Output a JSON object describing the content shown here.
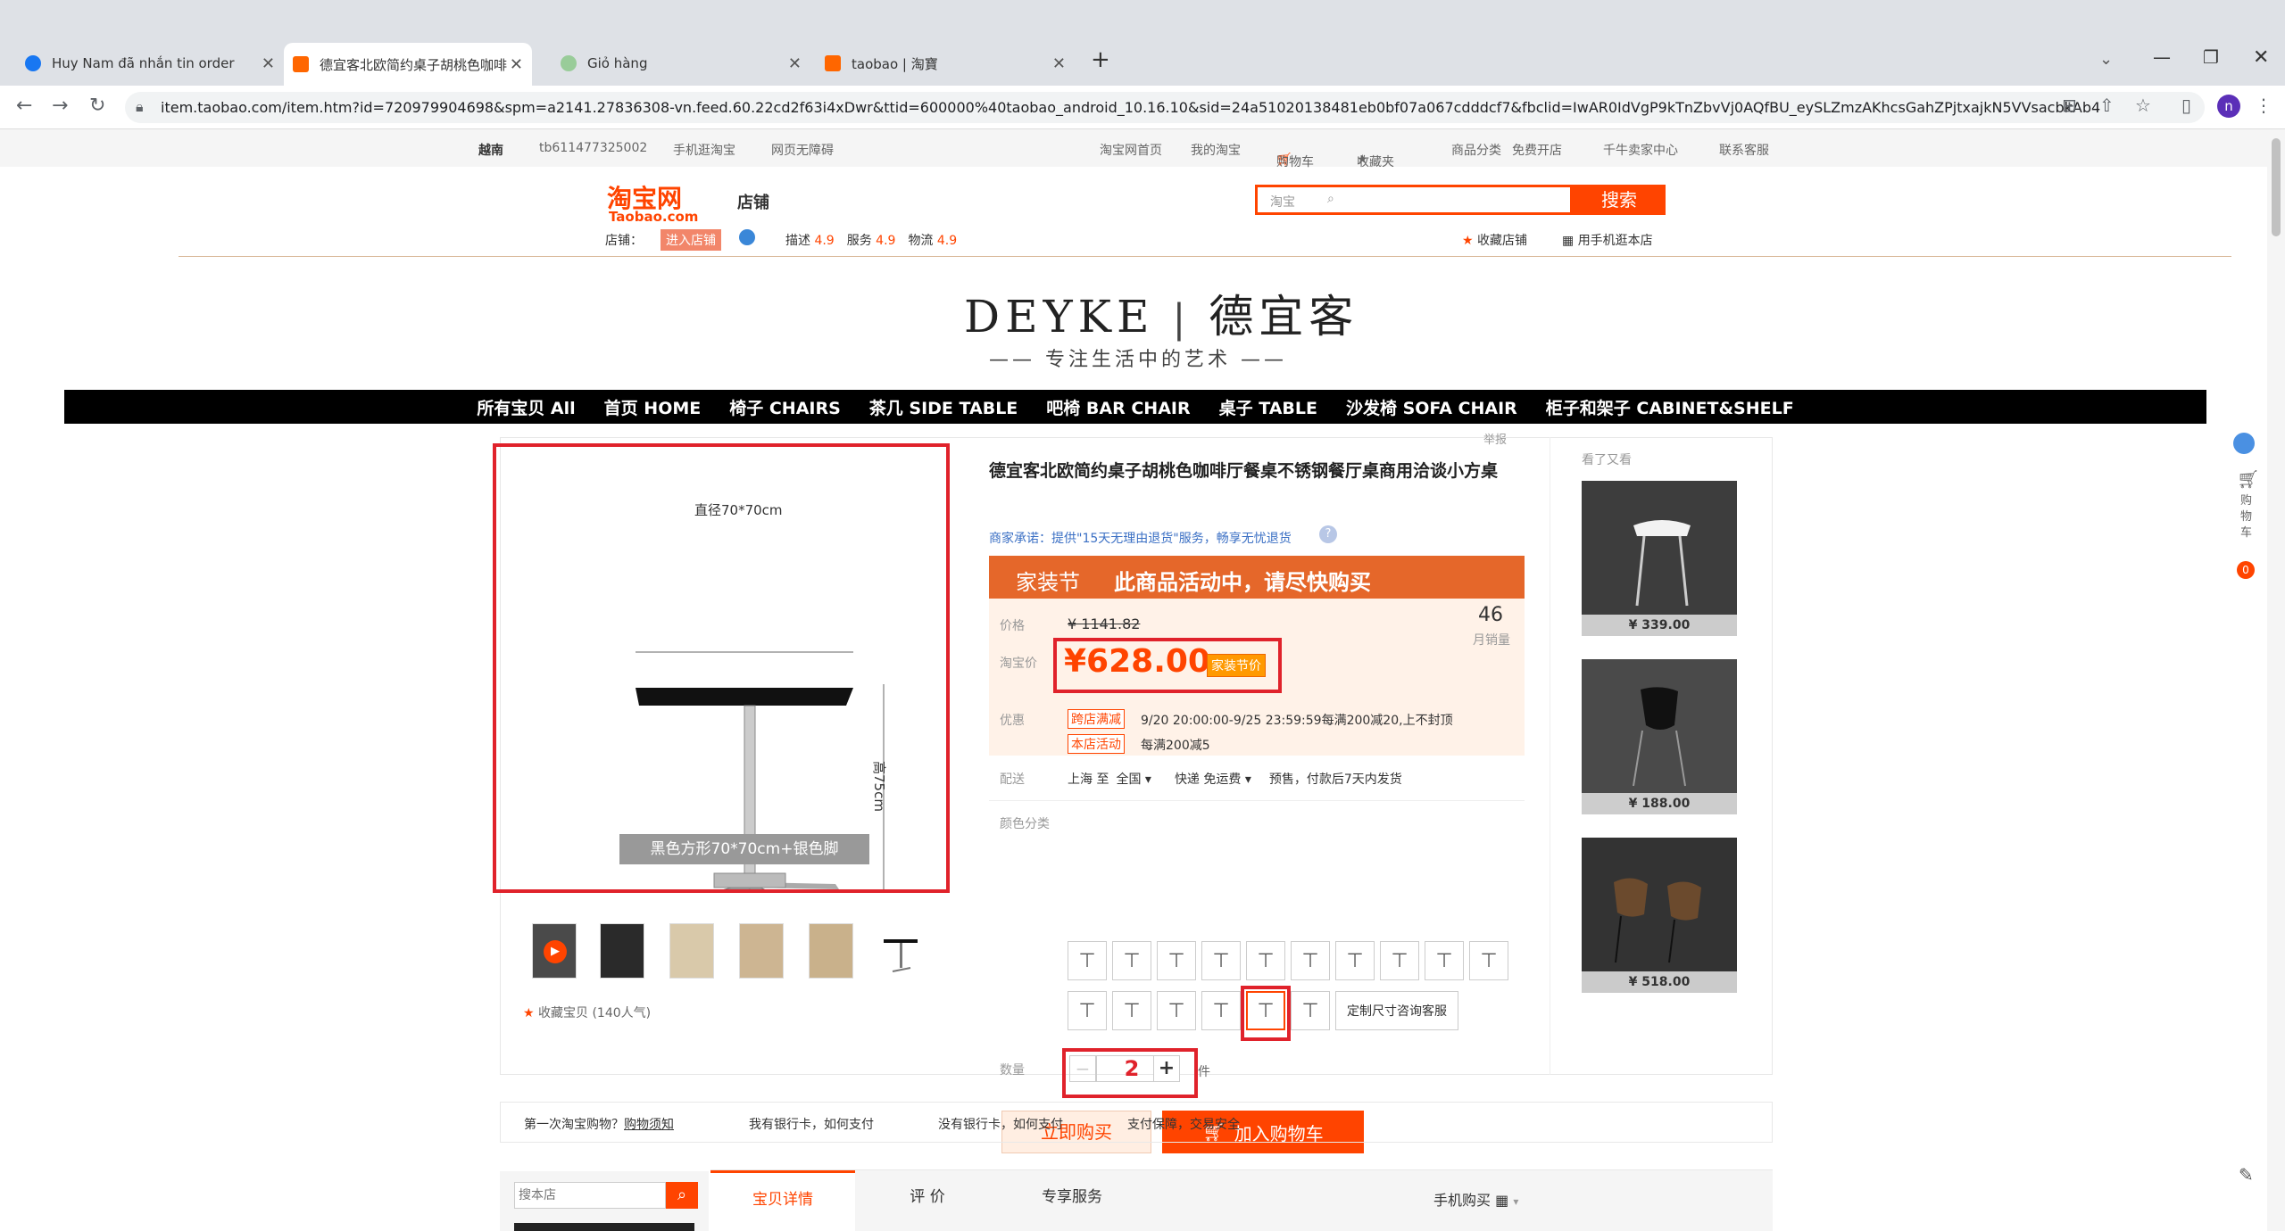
{
  "browser": {
    "tabs": [
      {
        "title": "Huy Nam đã nhắn tin order",
        "icon": "facebook-icon"
      },
      {
        "title": "德宜客北欧简约桌子胡桃色咖啡厅",
        "icon": "taobao-icon"
      },
      {
        "title": "Giỏ hàng",
        "icon": "globe-icon"
      },
      {
        "title": "taobao | 淘寶",
        "icon": "taobao-icon"
      }
    ],
    "new_tab": "+",
    "url": "item.taobao.com/item.htm?id=720979904698&spm=a2141.27836308-vn.feed.60.22cd2f63i4xDwr&ttid=600000%40taobao_android_10.16.10&sid=24a51020138481eb0bf07a067cdddcf7&fbclid=IwAR0IdVgP9kTnZbvVj0AQfBU_eySLZmzAKhcsGahZPjtxajkN5VVsacbkAb4",
    "profile": "n"
  },
  "sitebar": {
    "region": "越南",
    "user": "tb611477325002",
    "mobile": "手机逛淘宝",
    "accessible": "网页无障碍",
    "home": "淘宝网首页",
    "my": "我的淘宝",
    "cart": "购物车",
    "fav": "收藏夹",
    "category": "商品分类",
    "open": "免费开店",
    "seller": "千牛卖家中心",
    "service": "联系客服"
  },
  "header": {
    "logo_cn": "淘宝网",
    "logo_en": "Taobao.com",
    "store_label": "店铺",
    "search_scope": "淘宝",
    "search_button": "搜索",
    "shop_label": "店铺：",
    "enter_shop": "进入店铺",
    "ratings": [
      {
        "label": "描述",
        "value": "4.9"
      },
      {
        "label": "服务",
        "value": "4.9"
      },
      {
        "label": "物流",
        "value": "4.9"
      }
    ],
    "fav_shop": "收藏店铺",
    "mobile_shop": "用手机逛本店"
  },
  "brand": {
    "name_en": "DEYKE",
    "name_cn": "德宜客",
    "slogan": "专注生活中的艺术"
  },
  "nav": [
    "所有宝贝 All",
    "首页 HOME",
    "椅子 CHAIRS",
    "茶几 SIDE TABLE",
    "吧椅 BAR CHAIR",
    "桌子 TABLE",
    "沙发椅 SOFA CHAIR",
    "柜子和架子 CABINET&SHELF"
  ],
  "gallery": {
    "dim_width": "直径70*70cm",
    "dim_height": "高75cm",
    "caption": "黑色方形70*70cm+银色脚",
    "favorite": "收藏宝贝 (140人气)"
  },
  "product": {
    "report": "举报",
    "title": "德宜客北欧简约桌子胡桃色咖啡厅餐桌不锈钢餐厅桌商用洽谈小方桌",
    "promise": "商家承诺：提供\"15天无理由退货\"服务，畅享无忧退货",
    "banner_tag": "家装节",
    "banner_text": "此商品活动中，请尽快购买",
    "price_label": "价格",
    "orig_price": "¥ 1141.82",
    "sales_count": "46",
    "sales_label": "月销量",
    "tb_price_label": "淘宝价",
    "price": "¥628.00",
    "price_tag": "家装节价",
    "promo_label": "优惠",
    "promo1_tag": "跨店满减",
    "promo1_text": "9/20 20:00:00-9/25 23:59:59每满200减20,上不封顶",
    "promo2_tag": "本店活动",
    "promo2_text": "每满200减5",
    "ship_label": "配送",
    "ship_from": "上海 至",
    "ship_to": "全国",
    "ship_fee": "快递 免运费",
    "ship_note": "预售，付款后7天内发货",
    "color_label": "颜色分类",
    "custom_sku": "定制尺寸咨询客服",
    "qty_label": "数量",
    "qty_minus": "−",
    "qty_value": "2",
    "qty_plus": "+",
    "qty_unit": "件",
    "buy_now": "立即购买",
    "add_cart": "加入购物车"
  },
  "recommend": {
    "title": "看了又看",
    "items": [
      {
        "price": "¥ 339.00"
      },
      {
        "price": "¥ 188.00"
      },
      {
        "price": "¥ 518.00"
      }
    ]
  },
  "rightbar": {
    "cart": "购物车",
    "count": "0"
  },
  "guide": {
    "first": "第一次淘宝购物？",
    "first_link": "购物须知",
    "items": [
      "我有银行卡，如何支付",
      "没有银行卡，如何支付",
      "支付保障，交易安全"
    ]
  },
  "bottom": {
    "search_placeholder": "搜本店",
    "tabs": [
      "宝贝详情",
      "评 价",
      "专享服务"
    ],
    "mobile_buy": "手机购买"
  },
  "colors": {
    "accent": "#ff4400",
    "red_box": "#e0222b",
    "banner": "#e5672a"
  }
}
